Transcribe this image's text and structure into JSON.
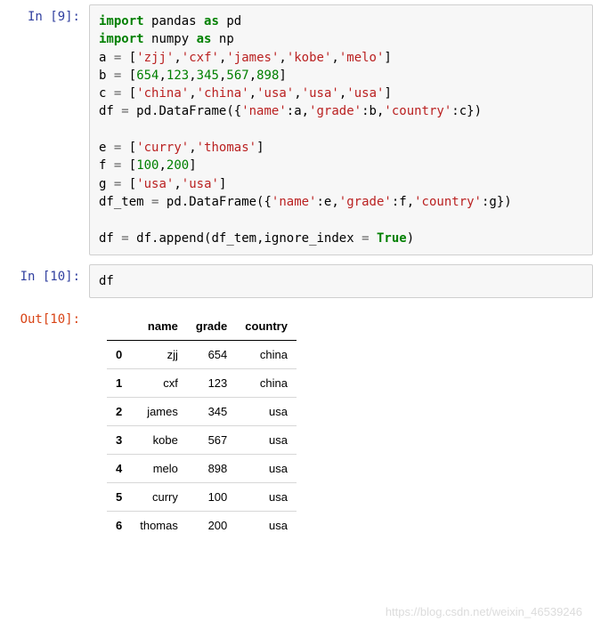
{
  "cells": {
    "c9": {
      "prompt": "In  [9]:",
      "code": {
        "l1": {
          "kw1": "import",
          "mod": "pandas",
          "kw2": "as",
          "alias": "pd"
        },
        "l2": {
          "kw1": "import",
          "mod": "numpy",
          "kw2": "as",
          "alias": "np"
        },
        "l3": {
          "var": "a",
          "v1": "'zjj'",
          "v2": "'cxf'",
          "v3": "'james'",
          "v4": "'kobe'",
          "v5": "'melo'"
        },
        "l4": {
          "var": "b",
          "n1": "654",
          "n2": "123",
          "n3": "345",
          "n4": "567",
          "n5": "898"
        },
        "l5": {
          "var": "c",
          "v1": "'china'",
          "v2": "'china'",
          "v3": "'usa'",
          "v4": "'usa'",
          "v5": "'usa'"
        },
        "l6": {
          "var": "df",
          "obj": "pd",
          "fn": "DataFrame",
          "k1": "'name'",
          "k2": "'grade'",
          "k3": "'country'",
          "r1": "a",
          "r2": "b",
          "r3": "c"
        },
        "l8": {
          "var": "e",
          "v1": "'curry'",
          "v2": "'thomas'"
        },
        "l9": {
          "var": "f",
          "n1": "100",
          "n2": "200"
        },
        "l10": {
          "var": "g",
          "v1": "'usa'",
          "v2": "'usa'"
        },
        "l11": {
          "var": "df_tem",
          "obj": "pd",
          "fn": "DataFrame",
          "k1": "'name'",
          "k2": "'grade'",
          "k3": "'country'",
          "r1": "e",
          "r2": "f",
          "r3": "g"
        },
        "l13": {
          "var": "df",
          "obj": "df",
          "fn": "append",
          "arg1": "df_tem",
          "kwarg": "ignore_index",
          "val": "True"
        }
      }
    },
    "c10": {
      "prompt": "In [10]:",
      "code": "df"
    },
    "out10": {
      "prompt": "Out[10]:"
    }
  },
  "chart_data": {
    "type": "table",
    "columns": [
      "name",
      "grade",
      "country"
    ],
    "index": [
      "0",
      "1",
      "2",
      "3",
      "4",
      "5",
      "6"
    ],
    "rows": [
      {
        "name": "zjj",
        "grade": "654",
        "country": "china"
      },
      {
        "name": "cxf",
        "grade": "123",
        "country": "china"
      },
      {
        "name": "james",
        "grade": "345",
        "country": "usa"
      },
      {
        "name": "kobe",
        "grade": "567",
        "country": "usa"
      },
      {
        "name": "melo",
        "grade": "898",
        "country": "usa"
      },
      {
        "name": "curry",
        "grade": "100",
        "country": "usa"
      },
      {
        "name": "thomas",
        "grade": "200",
        "country": "usa"
      }
    ]
  },
  "watermark": "https://blog.csdn.net/weixin_46539246"
}
